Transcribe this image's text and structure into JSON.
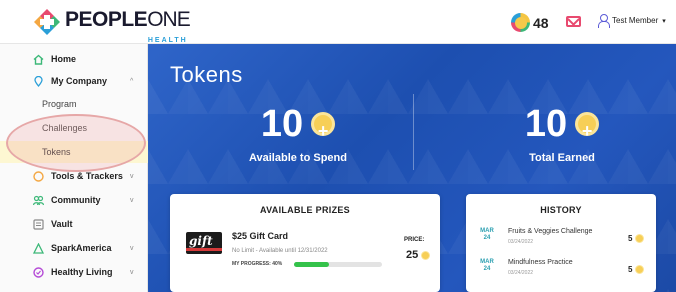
{
  "header": {
    "logo_text": "PEOPLE",
    "logo_text_2": "ONE",
    "logo_sub": "HEALTH",
    "token_count": "48",
    "user_name": "Test Member",
    "user_caret": "▾"
  },
  "sidebar": {
    "items": [
      {
        "label": "Home",
        "icon": "home-icon"
      },
      {
        "label": "My Company",
        "icon": "location-icon",
        "chevron": "^"
      },
      {
        "label": "Program"
      },
      {
        "label": "Challenges"
      },
      {
        "label": "Tokens"
      },
      {
        "label": "Tools & Trackers",
        "icon": "tools-icon",
        "chevron": "v"
      },
      {
        "label": "Community",
        "icon": "community-icon",
        "chevron": "v"
      },
      {
        "label": "Vault",
        "icon": "vault-icon"
      },
      {
        "label": "SparkAmerica",
        "icon": "spark-icon",
        "chevron": "v"
      },
      {
        "label": "Healthy Living",
        "icon": "healthy-living-icon",
        "chevron": "v"
      }
    ]
  },
  "hero": {
    "title": "Tokens",
    "available_value": "10",
    "available_label": "Available to Spend",
    "earned_value": "10",
    "earned_label": "Total Earned"
  },
  "prizes": {
    "title": "AVAILABLE PRIZES",
    "item_image_text": "gift",
    "item_name": "$25 Gift Card",
    "item_sub": "No Limit - Available until 12/31/2022",
    "progress_label": "MY PROGRESS: 40%",
    "progress_fraction": 0.4,
    "price_label": "PRICE:",
    "price_value": "25"
  },
  "history": {
    "title": "HISTORY",
    "entries": [
      {
        "month": "MAR",
        "day": "24",
        "name": "Fruits & Veggies Challenge",
        "date": "03/24/2022",
        "value": "5"
      },
      {
        "month": "MAR",
        "day": "24",
        "name": "Mindfulness Practice",
        "date": "03/24/2022",
        "value": "5"
      }
    ]
  },
  "colors": {
    "brand_blue": "#2457bd",
    "accent_gold": "#f7cf57",
    "progress_green": "#34c24a",
    "highlight_pink": "#e6a7a7"
  }
}
